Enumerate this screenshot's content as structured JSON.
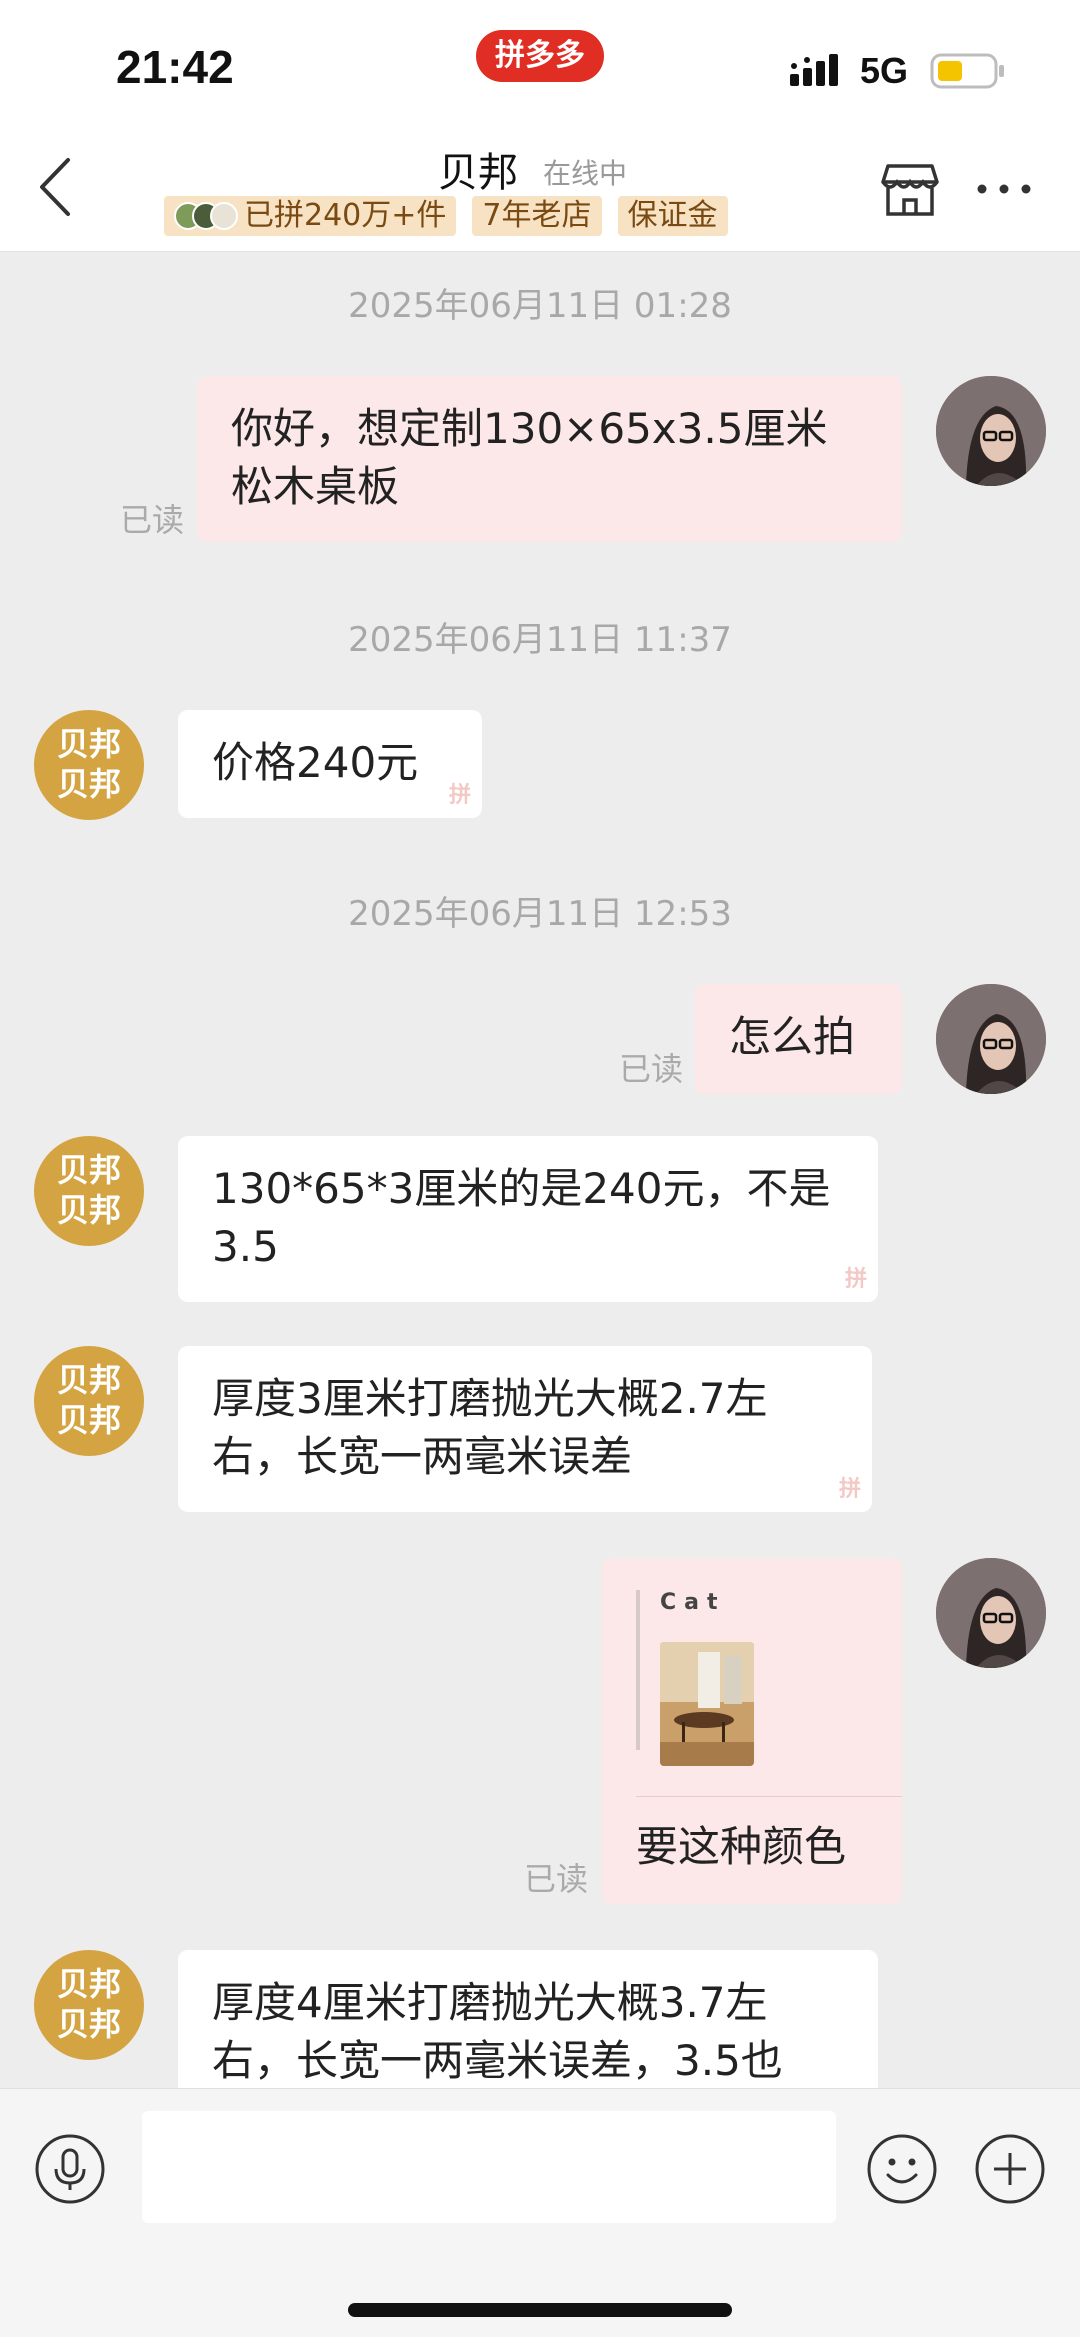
{
  "status_bar": {
    "time": "21:42",
    "app_badge": "拼多多",
    "network": "5G",
    "icons": [
      "signal-icon",
      "battery-icon"
    ]
  },
  "header": {
    "shop_name": "贝邦",
    "online_status": "在线中",
    "tags": [
      "已拼240万+件",
      "7年老店",
      "保证金"
    ],
    "icons": [
      "back-icon",
      "store-icon",
      "more-icon"
    ]
  },
  "chat": {
    "shop_avatar_text": [
      "贝邦",
      "贝邦"
    ],
    "watermark": "拼",
    "read_label": "已读",
    "timestamps": [
      "2025年06月11日 01:28",
      "2025年06月11日 11:37",
      "2025年06月11日 12:53"
    ],
    "messages": [
      {
        "from": "user",
        "text": "你好，想定制130×65x3.5厘米松木桌板",
        "read": true
      },
      {
        "from": "shop",
        "text": "价格240元"
      },
      {
        "from": "user",
        "text": "怎么拍",
        "read": true
      },
      {
        "from": "shop",
        "text": "130*65*3厘米的是240元，不是3.5"
      },
      {
        "from": "shop",
        "text": "厚度3厘米打磨抛光大概2.7左右，长宽一两毫米误差"
      },
      {
        "from": "user",
        "card_title": "Cat",
        "text": "要这种颜色",
        "read": true
      },
      {
        "from": "shop",
        "text": "厚度4厘米打磨抛光大概3.7左右，长宽一两毫米误差，3.5也"
      }
    ]
  },
  "input_bar": {
    "placeholder": "",
    "icons": [
      "microphone-icon",
      "emoji-icon",
      "plus-icon"
    ]
  },
  "colors": {
    "brand_red": "#e02e24",
    "shop_avatar": "#d4a442",
    "tag_bg": "#f7e2c4",
    "outgoing_bubble": "#fce8e8",
    "incoming_bubble": "#ffffff",
    "chat_bg": "#ededed"
  }
}
